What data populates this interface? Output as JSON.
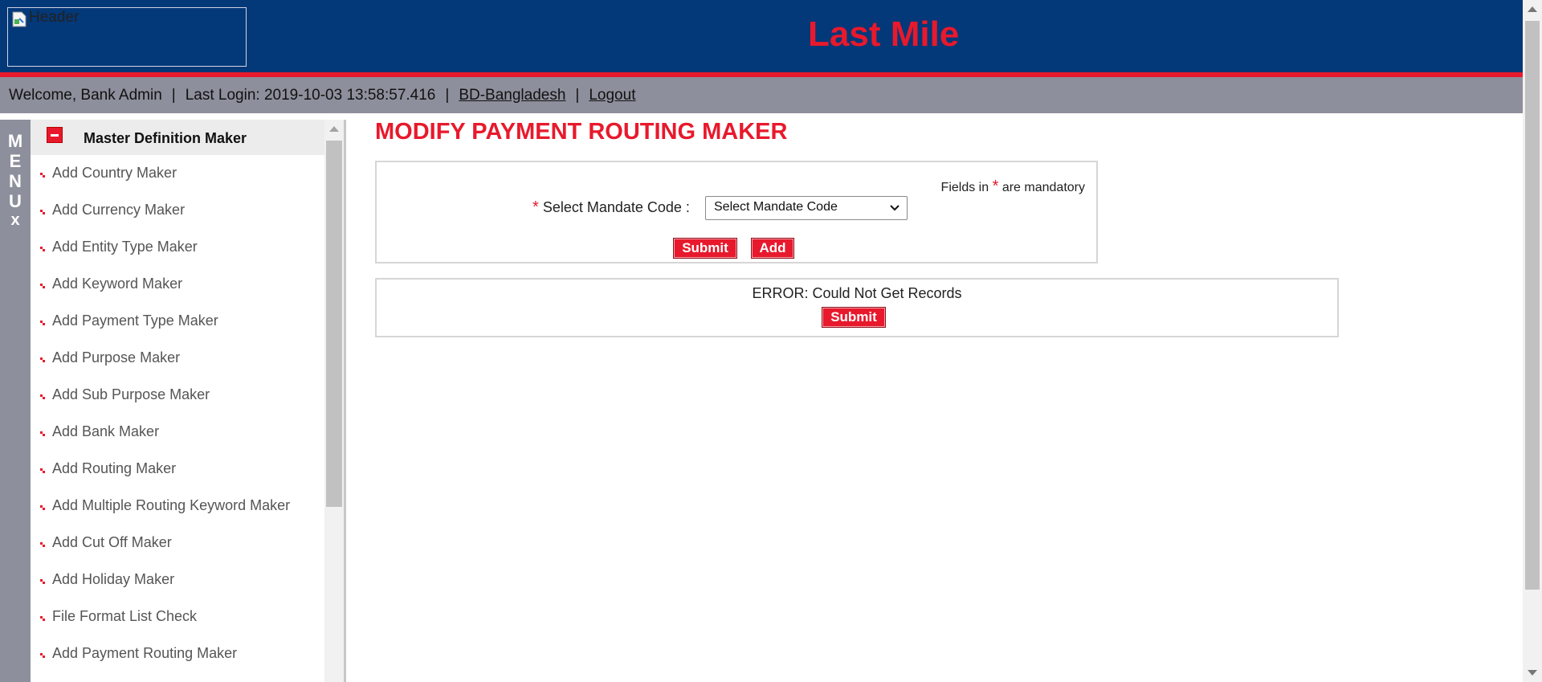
{
  "header": {
    "logo_alt": "Header",
    "app_title": "Last Mile",
    "logo_icon": "broken-image-icon"
  },
  "welcome_bar": {
    "welcome": "Welcome, Bank Admin",
    "last_login": "Last Login: 2019-10-03 13:58:57.416",
    "country_link": "BD-Bangladesh",
    "logout_link": "Logout",
    "separator": "|"
  },
  "menu_rail": {
    "letters": [
      "M",
      "E",
      "N",
      "U"
    ],
    "close_glyph": "x"
  },
  "sidebar": {
    "group_title": "Master Definition Maker",
    "items": [
      {
        "label": "Add Country Maker"
      },
      {
        "label": "Add Currency Maker"
      },
      {
        "label": "Add Entity Type Maker"
      },
      {
        "label": "Add Keyword Maker"
      },
      {
        "label": "Add Payment Type Maker"
      },
      {
        "label": "Add Purpose Maker"
      },
      {
        "label": "Add Sub Purpose Maker"
      },
      {
        "label": "Add Bank Maker"
      },
      {
        "label": "Add Routing Maker"
      },
      {
        "label": "Add Multiple Routing Keyword Maker"
      },
      {
        "label": "Add Cut Off Maker"
      },
      {
        "label": "Add Holiday Maker"
      },
      {
        "label": "File Format List Check"
      },
      {
        "label": "Add Payment Routing Maker"
      }
    ]
  },
  "main": {
    "page_title": "MODIFY PAYMENT ROUTING MAKER",
    "form": {
      "mandatory_prefix": "Fields in",
      "mandatory_star": "*",
      "mandatory_suffix": "are mandatory",
      "field_label": "Select Mandate Code :",
      "field_star": "*",
      "select_value": "Select Mandate Code",
      "submit_label": "Submit",
      "add_label": "Add"
    },
    "result": {
      "error_text": "ERROR: Could Not Get Records",
      "submit_label": "Submit"
    }
  },
  "colors": {
    "header_bg": "#033879",
    "accent_red": "#e8192c",
    "bar_gray": "#8e8f9c"
  }
}
